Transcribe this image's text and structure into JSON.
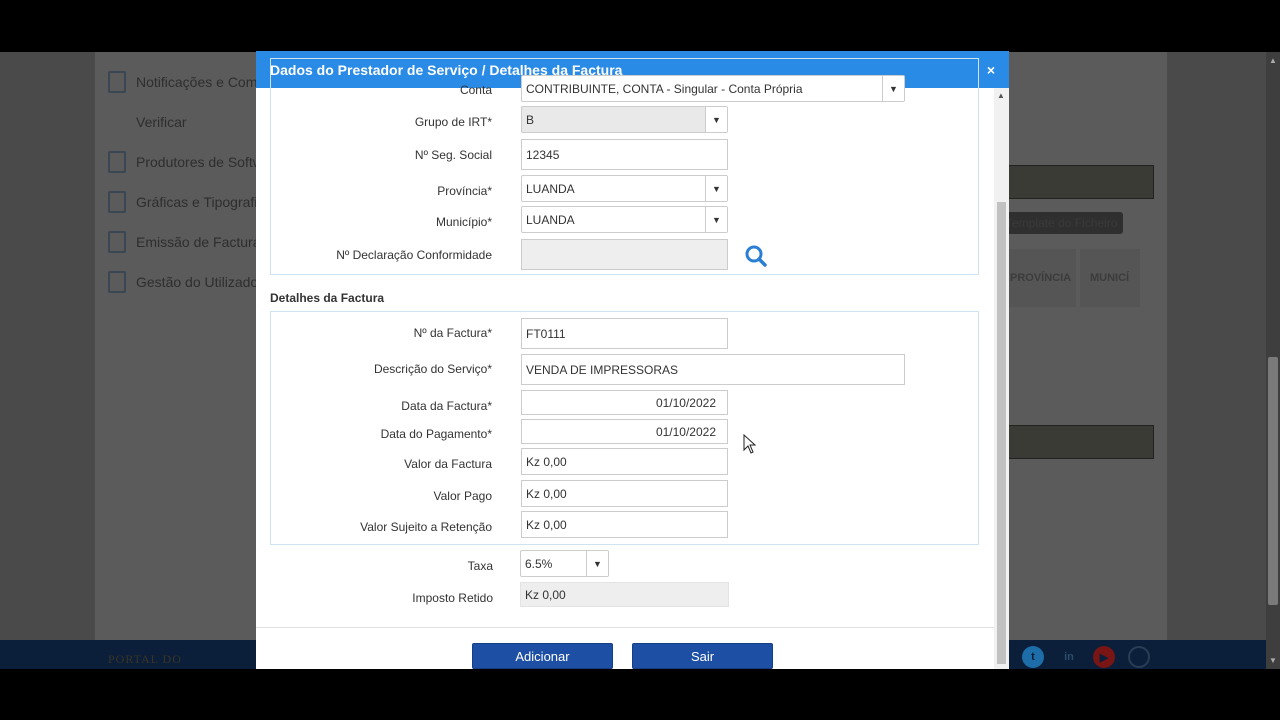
{
  "background": {
    "sidebar": [
      {
        "label": "Notificações e Comu",
        "icon": "document-icon"
      },
      {
        "label": "Verificar",
        "icon": null
      },
      {
        "label": "Produtores de Softw",
        "icon": "document-icon"
      },
      {
        "label": "Gráficas e Tipografia",
        "icon": "document-icon"
      },
      {
        "label": "Emissão de Facturas",
        "icon": "dollar-document-icon"
      },
      {
        "label": "Gestão do Utilizador",
        "icon": "user-document-icon"
      }
    ],
    "template_button": "Template do Ficheiro",
    "tab_provincia": "PROVÍNCIA",
    "tab_municipio": "MUNICÍ",
    "footer_text": "PORTAL DO"
  },
  "modal": {
    "title": "Dados do Prestador de Serviço / Detalhes da Factura",
    "close_label": "×",
    "provider": {
      "conta_label": "Conta",
      "conta_value": "CONTRIBUINTE, CONTA - Singular - Conta Própria",
      "grupo_irt_label": "Grupo de IRT*",
      "grupo_irt_value": "B",
      "seg_social_label": "Nº Seg. Social",
      "seg_social_value": "12345",
      "provincia_label": "Província*",
      "provincia_value": "LUANDA",
      "municipio_label": "Município*",
      "municipio_value": "LUANDA",
      "declaracao_label": "Nº Declaração Conformidade",
      "declaracao_value": ""
    },
    "invoice_section_title": "Detalhes da Factura",
    "invoice": {
      "numero_label": "Nº da Factura*",
      "numero_value": "FT0111",
      "descricao_label": "Descrição do Serviço*",
      "descricao_value": "VENDA DE IMPRESSORAS",
      "data_factura_label": "Data da Factura*",
      "data_factura_value": "01/10/2022",
      "data_pagamento_label": "Data do Pagamento*",
      "data_pagamento_value": "01/10/2022",
      "valor_factura_label": "Valor da Factura",
      "valor_factura_value": "Kz 0,00",
      "valor_pago_label": "Valor Pago",
      "valor_pago_value": "Kz 0,00",
      "valor_sujeito_label": "Valor Sujeito a Retenção",
      "valor_sujeito_value": "Kz 0,00"
    },
    "taxa_label": "Taxa",
    "taxa_value": "6.5%",
    "imposto_label": "Imposto Retido",
    "imposto_value": "Kz 0,00",
    "add_button": "Adicionar",
    "exit_button": "Sair"
  },
  "colors": {
    "header": "#2a8be6",
    "button": "#1d4fa5",
    "search_icon": "#2a7fd4"
  }
}
